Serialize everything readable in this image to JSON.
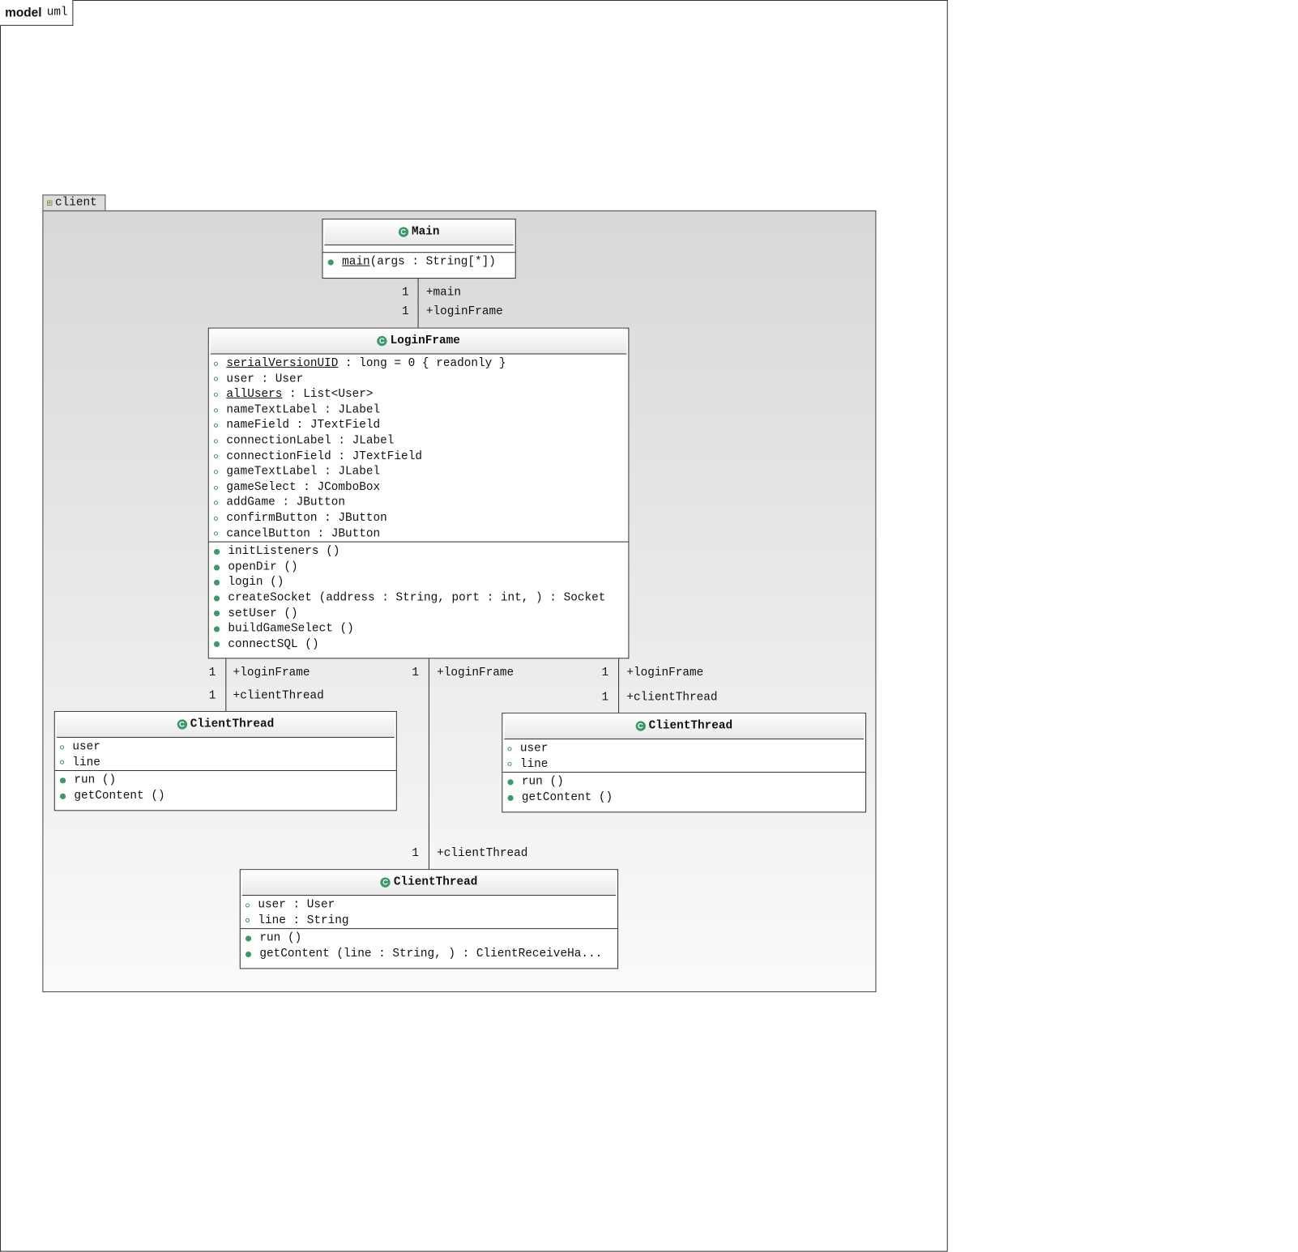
{
  "frame": {
    "keyword": "model",
    "name": "uml"
  },
  "package": {
    "name": "client"
  },
  "main": {
    "name": "Main",
    "ops": [
      {
        "name": "main",
        "underline": true,
        "rest": "(args : String[*])"
      }
    ]
  },
  "loginFrame": {
    "name": "LoginFrame",
    "attrs": [
      {
        "name": "serialVersionUID",
        "underline": true,
        "rest": " : long = 0 { readonly }"
      },
      {
        "name": "user",
        "rest": " : User"
      },
      {
        "name": "allUsers",
        "underline": true,
        "rest": " : List<User>"
      },
      {
        "name": "nameTextLabel",
        "rest": " : JLabel"
      },
      {
        "name": "nameField",
        "rest": " : JTextField"
      },
      {
        "name": "connectionLabel",
        "rest": " : JLabel"
      },
      {
        "name": "connectionField",
        "rest": " : JTextField"
      },
      {
        "name": "gameTextLabel",
        "rest": " : JLabel"
      },
      {
        "name": "gameSelect",
        "rest": " : JComboBox"
      },
      {
        "name": "addGame",
        "rest": " : JButton"
      },
      {
        "name": "confirmButton",
        "rest": " : JButton"
      },
      {
        "name": "cancelButton",
        "rest": " : JButton"
      }
    ],
    "ops": [
      {
        "name": "initListeners",
        "rest": " ()"
      },
      {
        "name": "openDir",
        "rest": " ()"
      },
      {
        "name": "login",
        "rest": " ()"
      },
      {
        "name": "createSocket",
        "rest": " (address : String, port : int, ) : Socket"
      },
      {
        "name": "setUser",
        "rest": " ()"
      },
      {
        "name": "buildGameSelect",
        "rest": " ()"
      },
      {
        "name": "connectSQL",
        "rest": " ()"
      }
    ]
  },
  "clientThreadLeft": {
    "name": "ClientThread",
    "attrs": [
      {
        "name": "user",
        "rest": ""
      },
      {
        "name": "line",
        "rest": ""
      }
    ],
    "ops": [
      {
        "name": "run",
        "rest": " ()"
      },
      {
        "name": "getContent",
        "rest": " ()"
      }
    ]
  },
  "clientThreadRight": {
    "name": "ClientThread",
    "attrs": [
      {
        "name": "user",
        "rest": ""
      },
      {
        "name": "line",
        "rest": ""
      }
    ],
    "ops": [
      {
        "name": "run",
        "rest": " ()"
      },
      {
        "name": "getContent",
        "rest": " ()"
      }
    ]
  },
  "clientThreadBottom": {
    "name": "ClientThread",
    "attrs": [
      {
        "name": "user",
        "rest": " : User"
      },
      {
        "name": "line",
        "rest": " : String"
      }
    ],
    "ops": [
      {
        "name": "run",
        "rest": " ()"
      },
      {
        "name": "getContent",
        "rest": " (line : String, ) : ClientReceiveHa..."
      }
    ]
  },
  "assoc": {
    "mainLogin": {
      "m1": "1",
      "r1": "+main",
      "m2": "1",
      "r2": "+loginFrame"
    },
    "left": {
      "m1": "1",
      "r1": "+loginFrame",
      "m2": "1",
      "r2": "+clientThread"
    },
    "mid": {
      "m1": "1",
      "r1": "+loginFrame",
      "m2": "1",
      "r2": "+clientThread"
    },
    "right": {
      "m1": "1",
      "r1": "+loginFrame",
      "m2": "1",
      "r2": "+clientThread"
    }
  },
  "colors": {
    "icon": "#3a9a6a"
  }
}
